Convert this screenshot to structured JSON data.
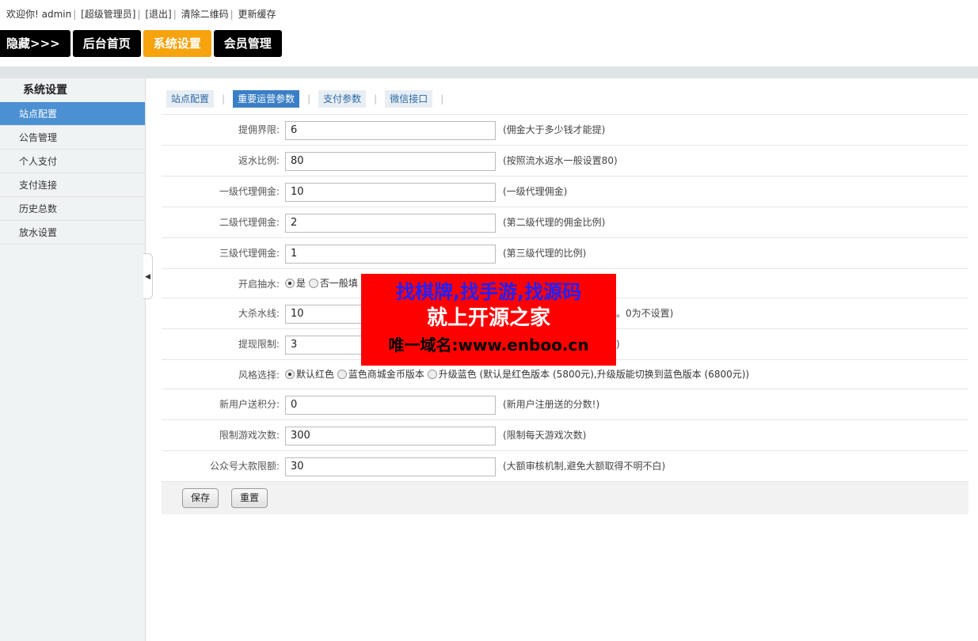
{
  "topbar": {
    "welcome": "欢迎你!",
    "user": "admin",
    "role": "[超级管理员]",
    "logout": "[退出]",
    "clear_qr": "清除二维码",
    "refresh_cache": "更新缓存"
  },
  "nav": {
    "hide": "隐藏>>>",
    "home": "后台首页",
    "settings": "系统设置",
    "members": "会员管理"
  },
  "sidebar": {
    "title": "系统设置",
    "items": [
      {
        "label": "站点配置"
      },
      {
        "label": "公告管理"
      },
      {
        "label": "个人支付"
      },
      {
        "label": "支付连接"
      },
      {
        "label": "历史总数"
      },
      {
        "label": "放水设置"
      }
    ]
  },
  "tabs": [
    {
      "label": "站点配置"
    },
    {
      "label": "重要运营参数"
    },
    {
      "label": "支付参数"
    },
    {
      "label": "微信接口"
    }
  ],
  "form": {
    "rows": [
      {
        "label": "提佣界限:",
        "value": "6",
        "hint": "(佣金大于多少钱才能提)"
      },
      {
        "label": "返水比例:",
        "value": "80",
        "hint": "(按照流水返水一般设置80)"
      },
      {
        "label": "一级代理佣金:",
        "value": "10",
        "hint": "(一级代理佣金)"
      },
      {
        "label": "二级代理佣金:",
        "value": "2",
        "hint": "(第二级代理的佣金比例)"
      },
      {
        "label": "三级代理佣金:",
        "value": "1",
        "hint": "(第三级代理的比例)"
      }
    ],
    "draw": {
      "label": "开启抽水:",
      "opt_yes": "是",
      "opt_no": "否一般填"
    },
    "kill": {
      "label": "大杀水线:",
      "value": "10",
      "hint": "杀。0为不设置)"
    },
    "withdraw": {
      "label": "提现限制:",
      "value": "3",
      "hint": ")"
    },
    "style": {
      "label": "风格选择:",
      "opt1": "默认红色",
      "opt2": "蓝色商城金币版本",
      "opt3": "升级蓝色 (默认是红色版本 (5800元),升级版能切换到蓝色版本 (6800元))"
    },
    "rows2": [
      {
        "label": "新用户送积分:",
        "value": "0",
        "hint": "(新用户注册送的分数!)"
      },
      {
        "label": "限制游戏次数:",
        "value": "300",
        "hint": "(限制每天游戏次数)"
      },
      {
        "label": "公众号大款限额:",
        "value": "30",
        "hint": "(大额审核机制,避免大额取得不明不白)"
      }
    ],
    "save": "保存",
    "reset": "重置"
  },
  "watermark": {
    "line1": "找棋牌,找手游,找源码",
    "line2": "就上开源之家",
    "line3": "唯一域名:www.enboo.cn"
  },
  "colors": {
    "accent": "#f6a30e",
    "active_tab": "#3a7fc5",
    "sidebar_active": "#4b90d2"
  }
}
